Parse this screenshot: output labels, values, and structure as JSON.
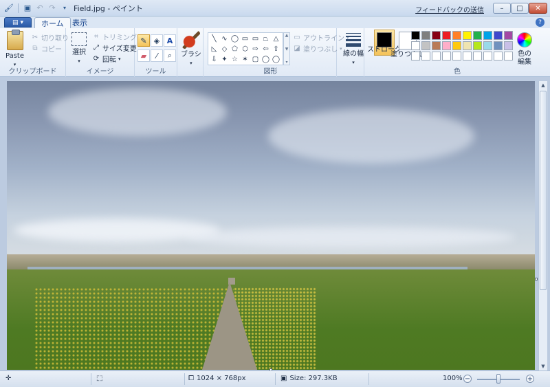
{
  "window": {
    "title": "Field.jpg - ペイント",
    "feedback": "フィードバックの送信",
    "minimize": "–",
    "maximize": "□",
    "close": "✕"
  },
  "tabs": {
    "home": "ホーム",
    "view": "表示",
    "help": "?"
  },
  "ribbon": {
    "clipboard": {
      "label": "クリップボード",
      "paste": "Paste",
      "cut": "切り取り",
      "copy": "コピー"
    },
    "image": {
      "label": "イメージ",
      "select": "選択",
      "crop": "トリミング",
      "resize": "サイズ変更",
      "rotate": "回転"
    },
    "tools": {
      "label": "ツール"
    },
    "brush": {
      "label": "ブラシ"
    },
    "shapes": {
      "label": "図形",
      "outline": "アウトライン",
      "fill": "塗りつぶし",
      "glyphs": [
        "╲",
        "∿",
        "◯",
        "▭",
        "▭",
        "⏢",
        "△",
        "◺",
        "◇",
        "⬠",
        "⬡",
        "⇨",
        "⇦",
        "⇧",
        "⇩",
        "✦",
        "☆",
        "✶",
        "▢",
        "◯",
        "◯"
      ]
    },
    "size": {
      "label": "線の幅"
    },
    "colors": {
      "label": "色",
      "color1": "ストローク",
      "color2": "塗りつぶし",
      "edit": "色の編集",
      "color1_value": "#000000",
      "color2_value": "#ffffff",
      "palette": [
        "#000000",
        "#7f7f7f",
        "#880015",
        "#ed1c24",
        "#ff7f27",
        "#fff200",
        "#22b14c",
        "#00a2e8",
        "#3f48cc",
        "#a349a4",
        "#ffffff",
        "#c3c3c3",
        "#b97a57",
        "#ffaec9",
        "#ffc90e",
        "#efe4b0",
        "#b5e61d",
        "#99d9ea",
        "#7092be",
        "#c8bfe7",
        "#ffffff",
        "#ffffff",
        "#ffffff",
        "#ffffff",
        "#ffffff",
        "#ffffff",
        "#ffffff",
        "#ffffff",
        "#ffffff",
        "#ffffff"
      ]
    }
  },
  "statusbar": {
    "dimensions": "1024 × 768px",
    "size": "Size: 297.3KB",
    "zoom": "100%"
  }
}
